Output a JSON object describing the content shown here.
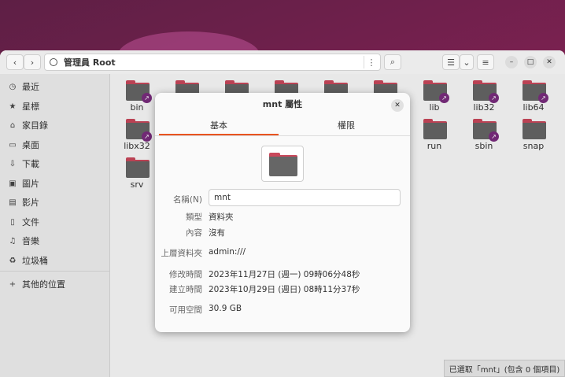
{
  "headerbar": {
    "back_icon": "chevron-left-icon",
    "forward_icon": "chevron-right-icon",
    "path_label": "管理員 Root",
    "search_icon": "search-icon",
    "list_view_icon": "list-view-icon",
    "view_dropdown_icon": "chevron-down-icon",
    "menu_icon": "hamburger-icon"
  },
  "sidebar": {
    "items": [
      {
        "label": "最近",
        "icon": "clock-icon"
      },
      {
        "label": "星標",
        "icon": "star-icon"
      },
      {
        "label": "家目錄",
        "icon": "home-icon"
      },
      {
        "label": "桌面",
        "icon": "desktop-icon"
      },
      {
        "label": "下載",
        "icon": "download-icon"
      },
      {
        "label": "圖片",
        "icon": "image-icon"
      },
      {
        "label": "影片",
        "icon": "video-icon"
      },
      {
        "label": "文件",
        "icon": "document-icon"
      },
      {
        "label": "音樂",
        "icon": "music-icon"
      },
      {
        "label": "垃圾桶",
        "icon": "trash-icon"
      },
      {
        "label": "其他的位置",
        "icon": "plus-icon"
      }
    ]
  },
  "folders": [
    {
      "name": "bin",
      "link": true
    },
    {
      "name": "",
      "link": false
    },
    {
      "name": "",
      "link": false
    },
    {
      "name": "",
      "link": false
    },
    {
      "name": "",
      "link": false
    },
    {
      "name": "",
      "link": false
    },
    {
      "name": "lib",
      "link": true
    },
    {
      "name": "lib32",
      "link": true
    },
    {
      "name": "lib64",
      "link": true
    },
    {
      "name": "libx32",
      "link": true
    },
    {
      "name": "run",
      "link": false
    },
    {
      "name": "sbin",
      "link": true
    },
    {
      "name": "snap",
      "link": false
    },
    {
      "name": "srv",
      "link": false
    }
  ],
  "status": "已選取「mnt」(包含 0 個項目)",
  "dialog": {
    "title": "mnt 屬性",
    "tabs": [
      "基本",
      "權限"
    ],
    "name_label": "名稱(N)",
    "name_value": "mnt",
    "type_label": "類型",
    "type_value": "資料夾",
    "contents_label": "內容",
    "contents_value": "沒有",
    "parent_label": "上層資料夾",
    "parent_value": "admin:///",
    "modified_label": "修改時間",
    "modified_value": "2023年11月27日 (週一) 09時06分48秒",
    "created_label": "建立時間",
    "created_value": "2023年10月29日 (週日) 08時11分37秒",
    "free_label": "可用空間",
    "free_value": "30.9 GB"
  },
  "colors": {
    "accent": "#e95420",
    "folder_tab": "#c9485b",
    "folder_body": "#666666",
    "link_badge": "#7a2d7e"
  }
}
